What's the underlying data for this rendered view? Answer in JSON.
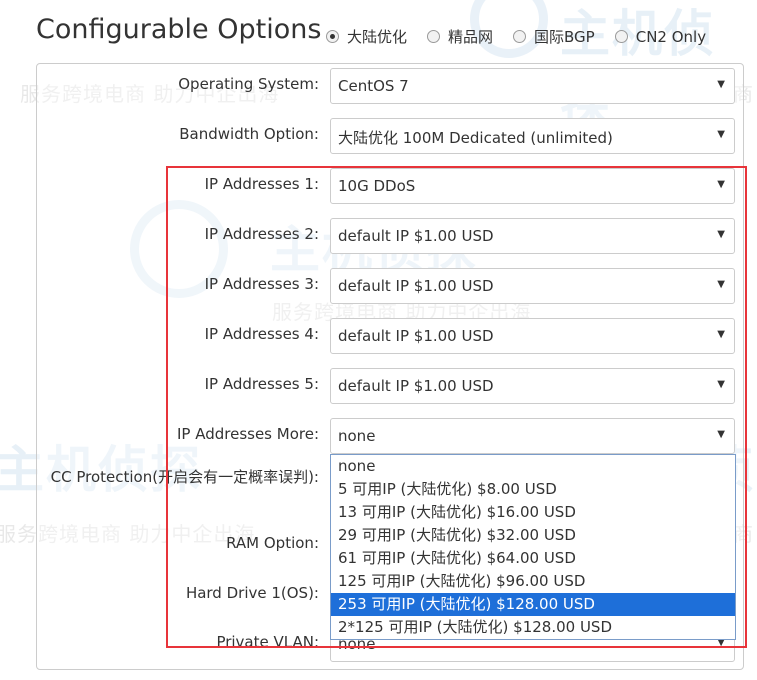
{
  "watermark": {
    "brand": "主机侦探",
    "slogan_short": "服务跨境电商",
    "slogan_full": "服务跨境电商 助力中企出海"
  },
  "title": "Configurable Options",
  "regions": [
    {
      "label": "大陆优化",
      "checked": true
    },
    {
      "label": "精品网",
      "checked": false
    },
    {
      "label": "国际BGP",
      "checked": false
    },
    {
      "label": "CN2 Only",
      "checked": false
    }
  ],
  "fields": {
    "os": {
      "label": "Operating System:",
      "value": "CentOS 7"
    },
    "bandwidth": {
      "label": "Bandwidth Option:",
      "value": "大陆优化 100M Dedicated (unlimited)"
    },
    "ip1": {
      "label": "IP Addresses 1:",
      "value": "10G DDoS"
    },
    "ip2": {
      "label": "IP Addresses 2:",
      "value": "default IP $1.00 USD"
    },
    "ip3": {
      "label": "IP Addresses 3:",
      "value": "default IP $1.00 USD"
    },
    "ip4": {
      "label": "IP Addresses 4:",
      "value": "default IP $1.00 USD"
    },
    "ip5": {
      "label": "IP Addresses 5:",
      "value": "default IP $1.00 USD"
    },
    "ip_more": {
      "label": "IP Addresses More:",
      "value": "none"
    },
    "cc": {
      "label": "CC Protection(开启会有一定概率误判):"
    },
    "ram": {
      "label": "RAM Option:"
    },
    "hdd": {
      "label": "Hard Drive 1(OS):"
    },
    "vlan": {
      "label": "Private VLAN:",
      "value": "none"
    }
  },
  "dropdown_options": [
    {
      "label": "none",
      "selected": false
    },
    {
      "label": "5 可用IP (大陆优化) $8.00 USD",
      "selected": false
    },
    {
      "label": "13 可用IP (大陆优化) $16.00 USD",
      "selected": false
    },
    {
      "label": "29 可用IP (大陆优化) $32.00 USD",
      "selected": false
    },
    {
      "label": "61 可用IP (大陆优化) $64.00 USD",
      "selected": false
    },
    {
      "label": "125 可用IP (大陆优化) $96.00 USD",
      "selected": false
    },
    {
      "label": "253 可用IP (大陆优化) $128.00 USD",
      "selected": true
    },
    {
      "label": "2*125 可用IP (大陆优化) $128.00 USD",
      "selected": false
    }
  ],
  "colors": {
    "highlight_border": "#e8343a",
    "selected_option_bg": "#1e6fd9"
  }
}
